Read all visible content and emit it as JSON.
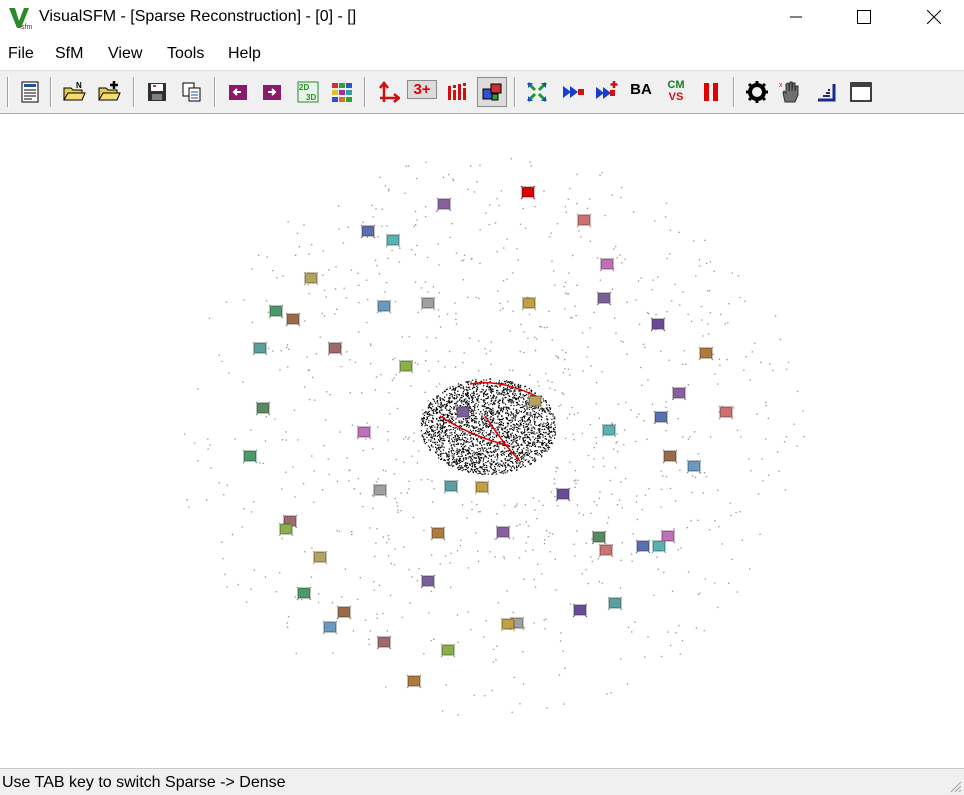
{
  "window": {
    "title": "VisualSFM - [Sparse Reconstruction] - [0] - []",
    "logo_icon": "visualsfm-logo-icon",
    "controls": [
      "minimize-icon",
      "maximize-icon",
      "close-icon"
    ]
  },
  "menu": {
    "items": [
      {
        "label": "File"
      },
      {
        "label": "SfM"
      },
      {
        "label": "View"
      },
      {
        "label": "Tools"
      },
      {
        "label": "Help"
      }
    ]
  },
  "toolbar": {
    "buttons": [
      {
        "icon": "log-window-icon"
      },
      {
        "icon": "open-images-icon"
      },
      {
        "icon": "add-images-icon"
      },
      {
        "icon": "save-nvm-icon"
      },
      {
        "icon": "copy-icon"
      },
      {
        "icon": "previous-model-icon"
      },
      {
        "icon": "next-model-icon"
      },
      {
        "icon": "switch-2d-3d-icon"
      },
      {
        "icon": "thumbnails-icon"
      },
      {
        "icon": "show-axis-icon"
      },
      {
        "icon": "point-filter-icon",
        "label": "3+",
        "pressed": true
      },
      {
        "icon": "histogram-icon"
      },
      {
        "icon": "cameras-icon",
        "pressed": true
      },
      {
        "icon": "compute-matches-icon"
      },
      {
        "icon": "sparse-reconstruction-icon"
      },
      {
        "icon": "incremental-reconstruction-icon"
      },
      {
        "icon": "bundle-adjustment-icon",
        "label": "BA"
      },
      {
        "icon": "dense-cmvs-icon",
        "label_top": "CM",
        "label_bottom": "VS"
      },
      {
        "icon": "pause-icon"
      },
      {
        "icon": "settings-gear-icon"
      },
      {
        "icon": "pan-hand-icon"
      },
      {
        "icon": "measure-tool-icon"
      },
      {
        "icon": "fullscreen-window-icon"
      }
    ]
  },
  "colors": {
    "accent_red": "#e00000",
    "point_cloud": "#000000",
    "sparse_points": "#9a8f8a",
    "camera_palette": [
      "#8a5fa0",
      "#5b8a5f",
      "#d07070",
      "#5a6fb0",
      "#58b3b3",
      "#c06fb8",
      "#b5a35a",
      "#7a5f9a",
      "#4a9a6a",
      "#9a6a4a",
      "#6a9ac0",
      "#a0a0a0",
      "#c0a040",
      "#6a4a9a",
      "#5aa0a0",
      "#a06a6a",
      "#8ab04a",
      "#b07a3a"
    ]
  },
  "status": {
    "text": "Use TAB key to switch Sparse -> Dense"
  }
}
